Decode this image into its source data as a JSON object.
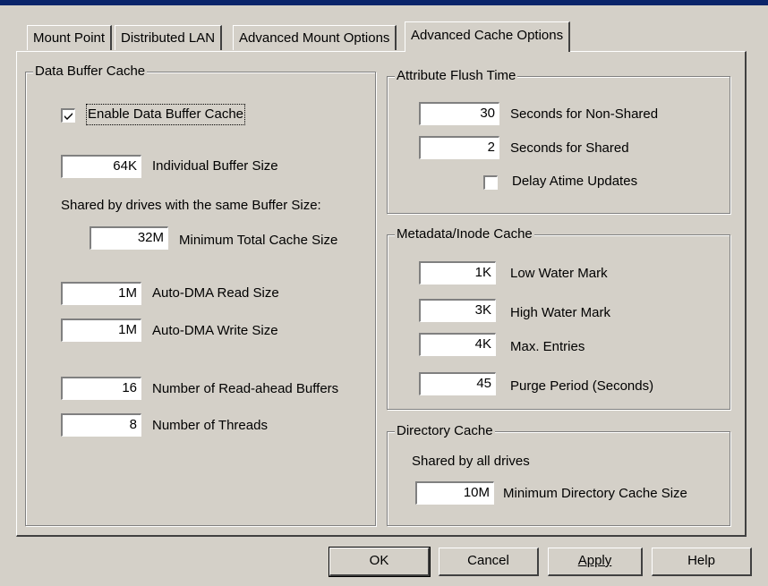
{
  "tabs": [
    {
      "label": "Mount Point"
    },
    {
      "label": "Distributed LAN"
    },
    {
      "label": "Advanced Mount Options"
    },
    {
      "label": "Advanced Cache Options"
    }
  ],
  "data_buffer": {
    "title": "Data Buffer Cache",
    "enable_label": "Enable Data Buffer Cache",
    "enable_checked": true,
    "buffer_size": {
      "value": "64K",
      "label": "Individual Buffer Size"
    },
    "shared_note": "Shared by drives with the same Buffer Size:",
    "min_total": {
      "value": "32M",
      "label": "Minimum Total Cache Size"
    },
    "dma_read": {
      "value": "1M",
      "label": "Auto-DMA Read Size"
    },
    "dma_write": {
      "value": "1M",
      "label": "Auto-DMA Write Size"
    },
    "readahead": {
      "value": "16",
      "label": "Number of Read-ahead Buffers"
    },
    "threads": {
      "value": "8",
      "label": "Number of Threads"
    }
  },
  "attr_flush": {
    "title": "Attribute Flush Time",
    "non_shared": {
      "value": "30",
      "label": "Seconds for Non-Shared"
    },
    "shared": {
      "value": "2",
      "label": "Seconds for Shared"
    },
    "delay_atime_label": "Delay Atime Updates",
    "delay_atime_checked": false
  },
  "metadata": {
    "title": "Metadata/Inode Cache",
    "low": {
      "value": "1K",
      "label": "Low Water Mark"
    },
    "high": {
      "value": "3K",
      "label": "High Water Mark"
    },
    "max": {
      "value": "4K",
      "label": "Max. Entries"
    },
    "purge": {
      "value": "45",
      "label": "Purge Period (Seconds)"
    }
  },
  "dir_cache": {
    "title": "Directory Cache",
    "note": "Shared by all drives",
    "min_size": {
      "value": "10M",
      "label": "Minimum Directory Cache Size"
    }
  },
  "buttons": {
    "ok": "OK",
    "cancel": "Cancel",
    "apply": "Apply",
    "help": "Help"
  },
  "colors": {
    "face": "#d4d0c8",
    "titlebar": "#0a246a"
  }
}
